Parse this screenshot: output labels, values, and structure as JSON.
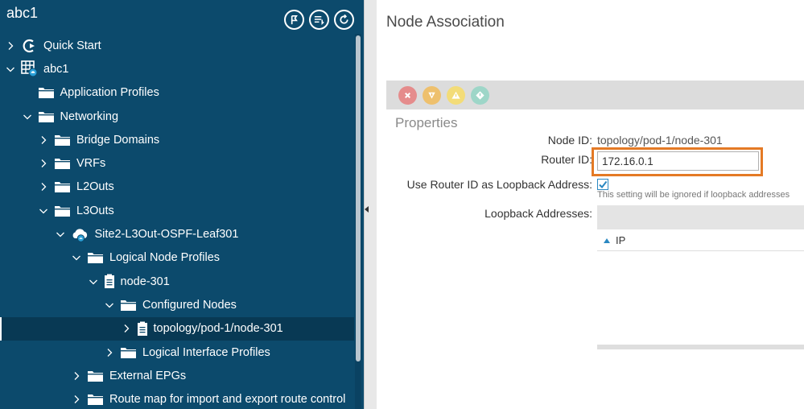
{
  "nav": {
    "title": "abc1",
    "tree": [
      {
        "label": "Quick Start",
        "indent": 0,
        "expander": "collapsed",
        "icon": "quick-start-icon"
      },
      {
        "label": "abc1",
        "indent": 0,
        "expander": "expanded",
        "icon": "tenant-icon"
      },
      {
        "label": "Application Profiles",
        "indent": 1,
        "expander": "none",
        "icon": "folder-icon"
      },
      {
        "label": "Networking",
        "indent": 1,
        "expander": "expanded",
        "icon": "folder-icon"
      },
      {
        "label": "Bridge Domains",
        "indent": 2,
        "expander": "collapsed",
        "icon": "folder-icon"
      },
      {
        "label": "VRFs",
        "indent": 2,
        "expander": "collapsed",
        "icon": "folder-icon"
      },
      {
        "label": "L2Outs",
        "indent": 2,
        "expander": "collapsed",
        "icon": "folder-icon"
      },
      {
        "label": "L3Outs",
        "indent": 2,
        "expander": "expanded",
        "icon": "folder-icon"
      },
      {
        "label": "Site2-L3Out-OSPF-Leaf301",
        "indent": 3,
        "expander": "expanded",
        "icon": "cloud-icon"
      },
      {
        "label": "Logical Node Profiles",
        "indent": 4,
        "expander": "expanded",
        "icon": "folder-icon"
      },
      {
        "label": "node-301",
        "indent": 5,
        "expander": "expanded",
        "icon": "document-icon"
      },
      {
        "label": "Configured Nodes",
        "indent": 6,
        "expander": "expanded",
        "icon": "folder-icon"
      },
      {
        "label": "topology/pod-1/node-301",
        "indent": 7,
        "expander": "collapsed",
        "icon": "document-icon",
        "selected": true
      },
      {
        "label": "Logical Interface Profiles",
        "indent": 6,
        "expander": "collapsed",
        "icon": "folder-icon"
      },
      {
        "label": "External EPGs",
        "indent": 4,
        "expander": "collapsed",
        "icon": "folder-icon"
      },
      {
        "label": "Route map for import and export route control",
        "indent": 4,
        "expander": "collapsed",
        "icon": "folder-icon"
      }
    ],
    "header_icons": [
      "location-marker-icon",
      "list-filter-icon",
      "refresh-icon"
    ]
  },
  "content": {
    "title": "Node Association",
    "fault_icons": [
      "critical-fault-icon",
      "major-fault-icon",
      "minor-fault-icon",
      "warning-fault-icon"
    ],
    "fault_colors": [
      "#e58c8c",
      "#eec06d",
      "#f3dc78",
      "#9ed6c8"
    ],
    "properties_title": "Properties",
    "node_id_label": "Node ID:",
    "node_id_value": "topology/pod-1/node-301",
    "router_id_label": "Router ID:",
    "router_id_value": "172.16.0.1",
    "loopback_use_label": "Use Router ID as Loopback Address:",
    "loopback_use_checked": true,
    "loopback_note": "This setting will be ignored if loopback addresses",
    "loopback_addresses_label": "Loopback Addresses:",
    "loopback_table_column": "IP"
  },
  "colors": {
    "nav_background": "#0c4a6c",
    "nav_selected": "#083954",
    "highlight_box": "#e47a25",
    "accent": "#2a88c2"
  }
}
